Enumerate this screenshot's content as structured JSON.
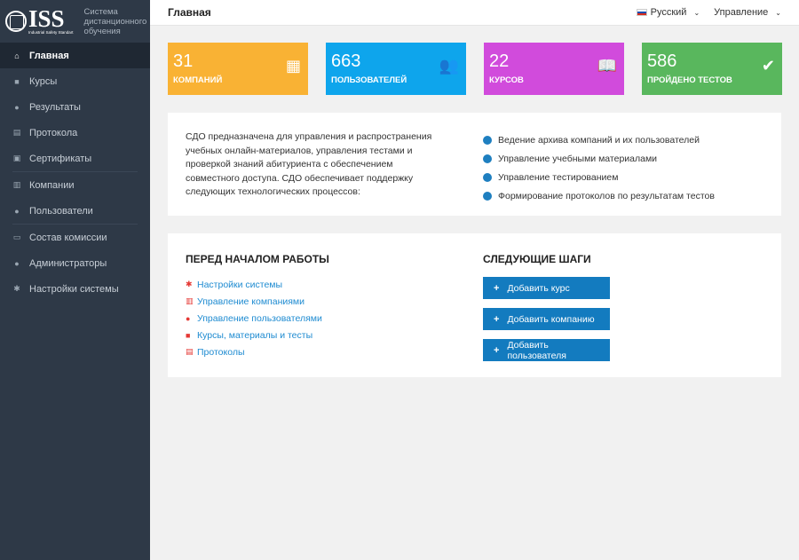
{
  "logo": {
    "name": "ISS",
    "tagline": "Industrial Safety Standart",
    "caption_line1": "Система",
    "caption_line2": "дистанционного",
    "caption_line3": "обучения"
  },
  "sidebar": {
    "items": [
      {
        "label": "Главная",
        "icon": "home-icon",
        "glyph": "⌂"
      },
      {
        "label": "Курсы",
        "icon": "courses-icon",
        "glyph": "■"
      },
      {
        "label": "Результаты",
        "icon": "results-icon",
        "glyph": "●"
      },
      {
        "label": "Протокола",
        "icon": "protocol-icon",
        "glyph": "▤"
      },
      {
        "label": "Сертификаты",
        "icon": "certificate-icon",
        "glyph": "▣"
      },
      {
        "label": "Компании",
        "icon": "company-icon",
        "glyph": "▥"
      },
      {
        "label": "Пользователи",
        "icon": "users-icon",
        "glyph": "●"
      },
      {
        "label": "Состав комиссии",
        "icon": "commission-icon",
        "glyph": "▭"
      },
      {
        "label": "Администраторы",
        "icon": "admin-icon",
        "glyph": "●"
      },
      {
        "label": "Настройки системы",
        "icon": "gear-icon",
        "glyph": "✱"
      }
    ]
  },
  "header": {
    "title": "Главная",
    "language": "Русский",
    "menu": "Управление"
  },
  "stats": [
    {
      "value": "31",
      "label": "Компаний",
      "color": "#f9b234",
      "icon": "building-icon",
      "glyph": "▦"
    },
    {
      "value": "663",
      "label": "Пользователей",
      "color": "#0ea5ec",
      "icon": "users-icon",
      "glyph": "👥"
    },
    {
      "value": "22",
      "label": "Курсов",
      "color": "#d14bdc",
      "icon": "book-icon",
      "glyph": "📖"
    },
    {
      "value": "586",
      "label": "Пройдено тестов",
      "color": "#59b75d",
      "icon": "user-check-icon",
      "glyph": "✔"
    }
  ],
  "intro": {
    "text": "СДО предназначена для управления и распространения учебных онлайн-материалов, управления тестами и проверкой знаний абитуриента с обеспечением совместного доступа. СДО обеспечивает поддержку следующих технологических процессов:",
    "features": [
      "Ведение архива компаний и их пользователей",
      "Управление учебными материалами",
      "Управление тестированием",
      "Формирование протоколов по результатам тестов"
    ]
  },
  "before_start": {
    "title": "ПЕРЕД НАЧАЛОМ РАБОТЫ",
    "links": [
      {
        "label": "Настройки системы",
        "icon": "gear-icon",
        "glyph": "✱"
      },
      {
        "label": "Управление компаниями",
        "icon": "company-icon",
        "glyph": "▥"
      },
      {
        "label": "Управление пользователями",
        "icon": "users-icon",
        "glyph": "●"
      },
      {
        "label": "Курсы, материалы и тесты",
        "icon": "courses-icon",
        "glyph": "■"
      },
      {
        "label": "Протоколы",
        "icon": "protocol-icon",
        "glyph": "▤"
      }
    ]
  },
  "next_steps": {
    "title": "СЛЕДУЮЩИЕ ШАГИ",
    "buttons": [
      "Добавить курс",
      "Добавить компанию",
      "Добавить пользователя"
    ]
  },
  "colors": {
    "sidebar_bg": "#2e3947",
    "accent": "#137bbf",
    "link": "#1e8bd1",
    "link_icon": "#e53935"
  }
}
